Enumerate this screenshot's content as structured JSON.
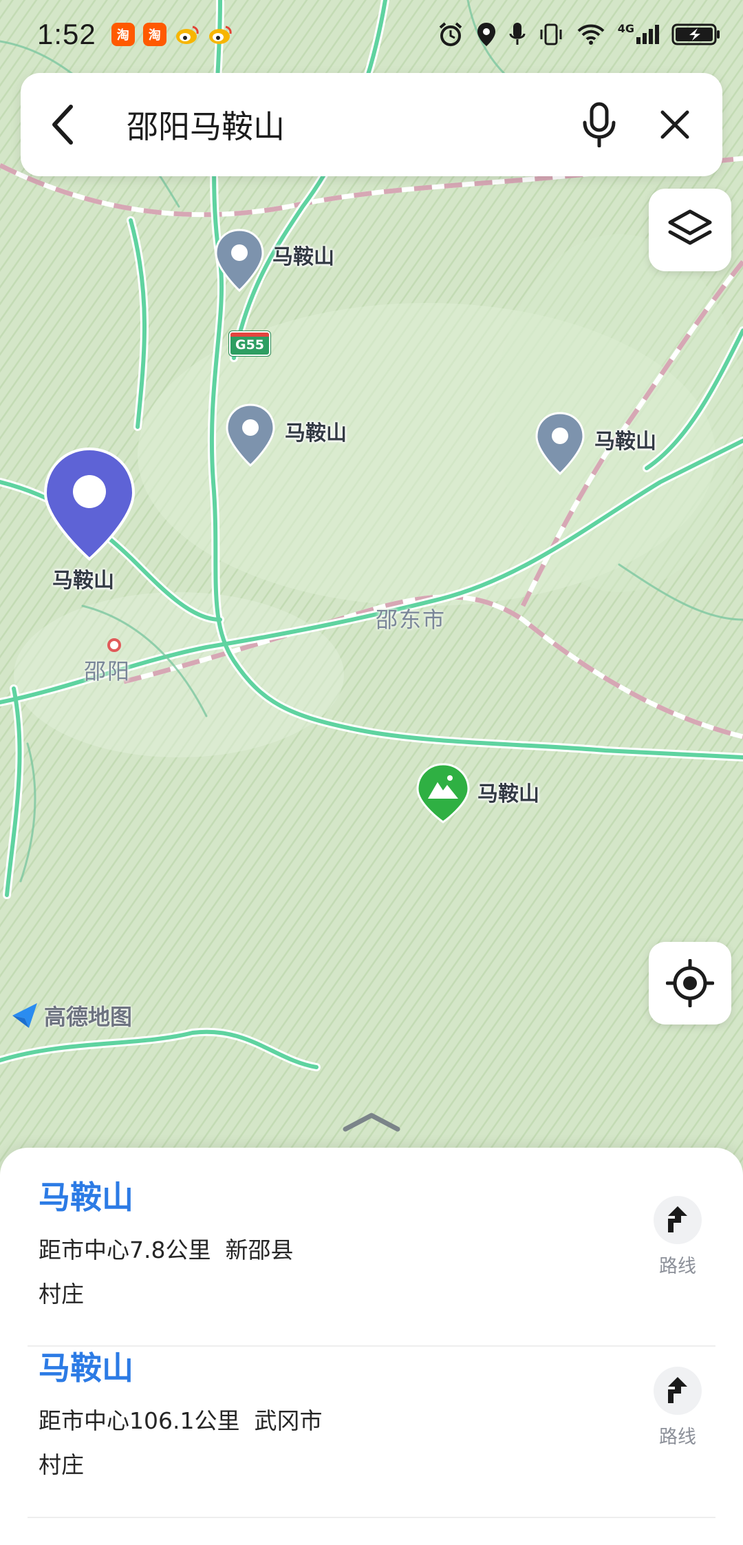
{
  "status_bar": {
    "time": "1:52",
    "app_icons": [
      {
        "name": "taobao-icon",
        "glyph": "淘",
        "color": "#ff5a00"
      },
      {
        "name": "taobao-icon",
        "glyph": "淘",
        "color": "#ff5a00"
      },
      {
        "name": "weibo-icon",
        "glyph": "",
        "color": "#f7b500"
      },
      {
        "name": "weibo-icon",
        "glyph": "",
        "color": "#f7b500"
      }
    ],
    "network": "4G"
  },
  "search": {
    "query": "邵阳马鞍山"
  },
  "map": {
    "markers": [
      {
        "label": "马鞍山",
        "type": "poi"
      },
      {
        "label": "马鞍山",
        "type": "poi"
      },
      {
        "label": "马鞍山",
        "type": "poi"
      },
      {
        "label": "马鞍山",
        "type": "selected"
      },
      {
        "label": "马鞍山",
        "type": "scenic"
      }
    ],
    "cities": [
      "邵东市",
      "邵阳"
    ],
    "road_shield": "G55",
    "brand": "高德地图",
    "colors": {
      "pin_gray": "#7d93ad",
      "pin_selected": "#5e63d6",
      "pin_scenic": "#2fb043",
      "road": "#5fd3a0",
      "rail": "#d59aa9"
    }
  },
  "results": [
    {
      "name": "马鞍山",
      "distance": "距市中心7.8公里",
      "region": "新邵县",
      "category": "村庄",
      "route_label": "路线"
    },
    {
      "name": "马鞍山",
      "distance": "距市中心106.1公里",
      "region": "武冈市",
      "category": "村庄",
      "route_label": "路线"
    }
  ]
}
